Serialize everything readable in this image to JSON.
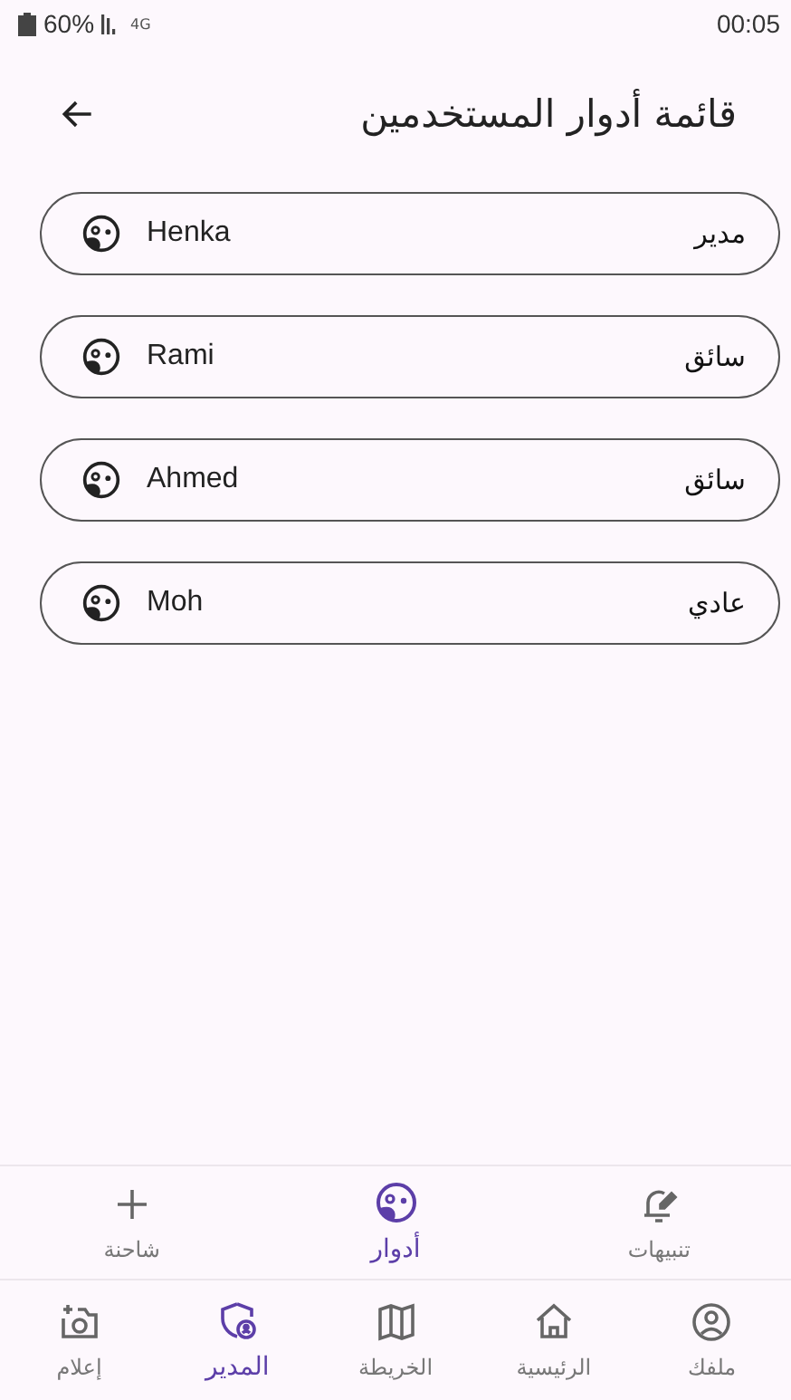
{
  "status_bar": {
    "battery": "60%",
    "network": "4G",
    "time": "00:05"
  },
  "header": {
    "title": "قائمة أدوار المستخدمين"
  },
  "users": [
    {
      "name": "Henka",
      "role": "مدير"
    },
    {
      "name": "Rami",
      "role": "سائق"
    },
    {
      "name": "Ahmed",
      "role": "سائق"
    },
    {
      "name": "Moh",
      "role": "عادي"
    }
  ],
  "sub_nav": [
    {
      "label": "تنبيهات",
      "kind": "bell",
      "selected": false
    },
    {
      "label": "أدوار",
      "kind": "roles",
      "selected": true
    },
    {
      "label": "شاحنة",
      "kind": "plus",
      "selected": false
    }
  ],
  "bottom_nav": [
    {
      "label": "ملفك",
      "kind": "profile",
      "selected": false
    },
    {
      "label": "الرئيسية",
      "kind": "home",
      "selected": false
    },
    {
      "label": "الخريطة",
      "kind": "map",
      "selected": false
    },
    {
      "label": "المدير",
      "kind": "admin",
      "selected": true
    },
    {
      "label": "إعلام",
      "kind": "camera",
      "selected": false
    }
  ]
}
